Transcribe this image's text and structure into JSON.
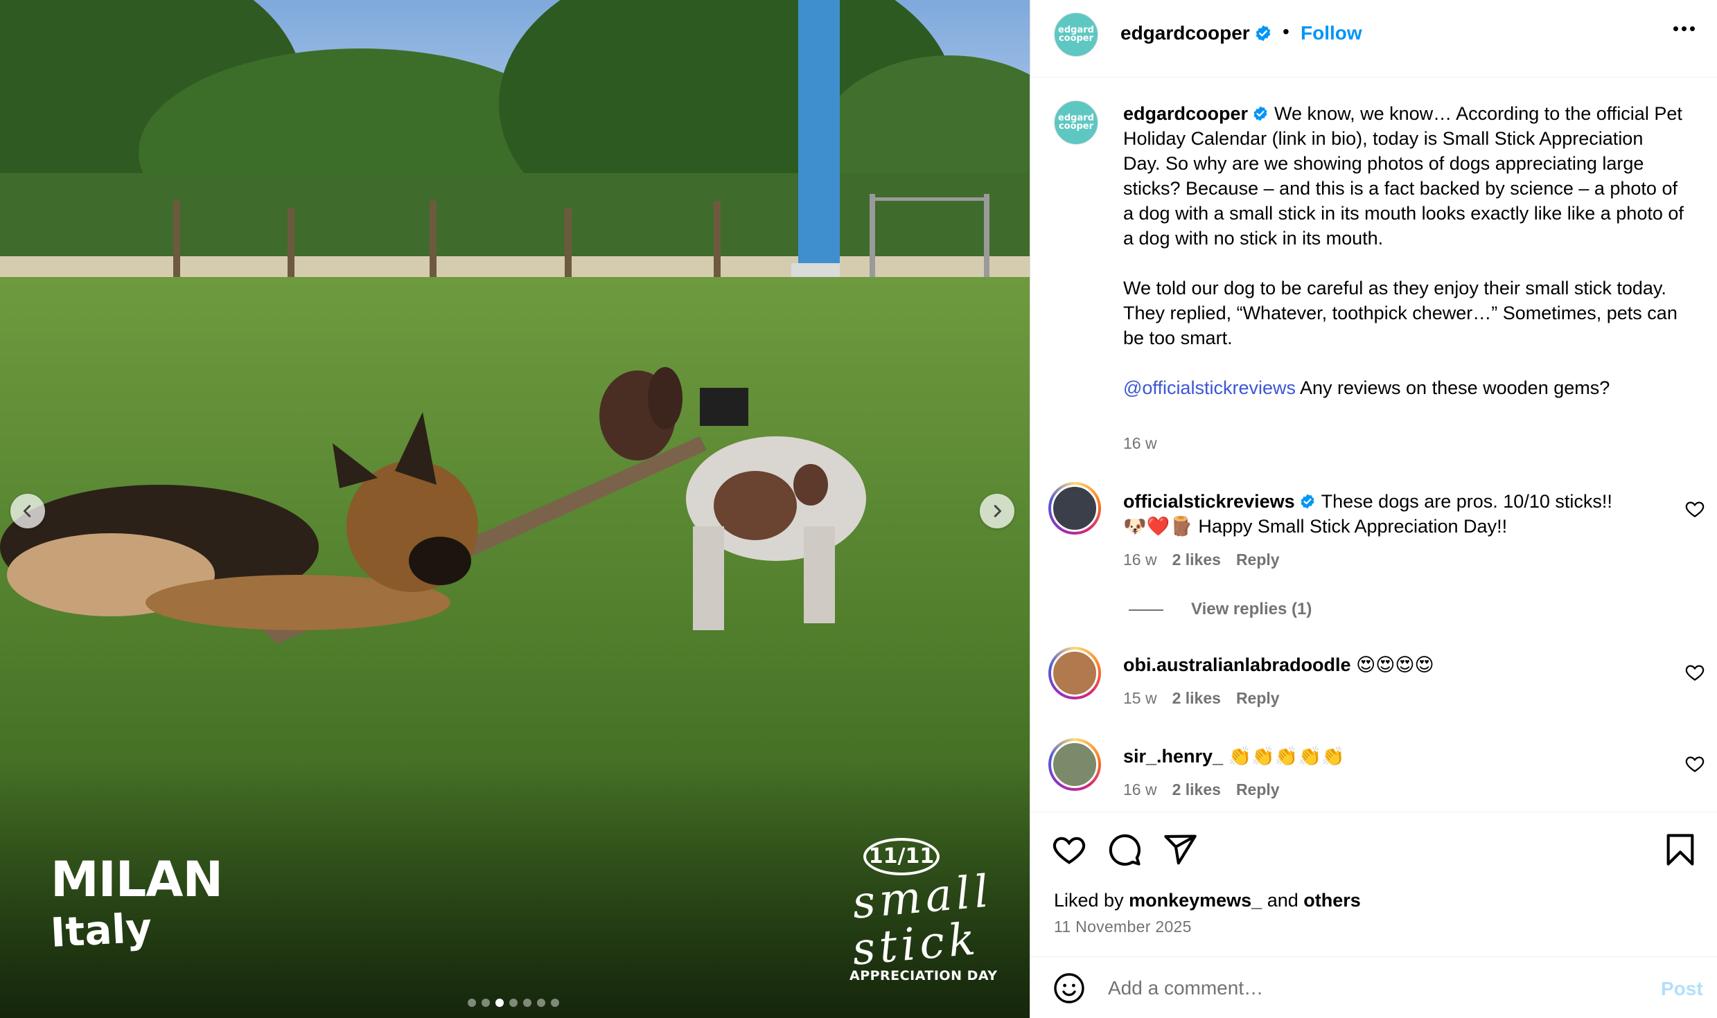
{
  "photo": {
    "city": "MILAN",
    "country": "Italy",
    "badge_date": "11/11",
    "badge_word_1": "small",
    "badge_word_2": "stick",
    "badge_sub": "APPRECIATION DAY",
    "carousel_total": 7,
    "carousel_active": 3
  },
  "header": {
    "avatar_text_1": "edgard",
    "avatar_text_2": "cooper",
    "username": "edgardcooper",
    "separator": "•",
    "follow_label": "Follow"
  },
  "caption": {
    "username": "edgardcooper",
    "para1": "We know, we know… According to the official Pet Holiday Calendar (link in bio), today is Small Stick Appreciation Day. So why are we showing photos of dogs appreciating large sticks? Because – and this is a fact backed by science – a photo of a dog with a small stick in its mouth looks exactly like like a photo of a dog with no stick in its mouth.",
    "para2": "We told our dog to be careful as they enjoy their small stick today. They replied, “Whatever, toothpick chewer…” Sometimes, pets can be too smart.",
    "mention": "@officialstickreviews",
    "para3_rest": " Any reviews on these wooden gems?",
    "time": "16 w"
  },
  "comments": [
    {
      "username": "officialstickreviews",
      "verified": true,
      "text_line1": "These dogs are pros. 10/10 sticks!!",
      "emoji": "🐶❤️🪵",
      "text_line2": "Happy Small Stick Appreciation Day!!",
      "time": "16 w",
      "likes": "2 likes",
      "reply": "Reply",
      "view_replies": "View replies (1)"
    },
    {
      "username": "obi.australianlabradoodle",
      "text": "😍😍😍😍",
      "time": "15 w",
      "likes": "2 likes",
      "reply": "Reply"
    },
    {
      "username": "sir_.henry_",
      "text": "👏👏👏👏👏",
      "time": "16 w",
      "likes": "2 likes",
      "reply": "Reply"
    }
  ],
  "actions": {
    "liked_prefix": "Liked by ",
    "liked_user": "monkeymews_",
    "liked_mid": " and ",
    "liked_others": "others",
    "date": "11 November 2025"
  },
  "comment_box": {
    "placeholder": "Add a comment…",
    "post_label": "Post"
  },
  "colors": {
    "link_blue": "#0095f6",
    "mention_blue": "#3d56d6",
    "muted_gray": "#737373",
    "brand_teal": "#5fc7c2"
  },
  "icons": [
    "chevron-left-icon",
    "chevron-right-icon",
    "verified-badge-icon",
    "more-options-icon",
    "heart-icon",
    "comment-icon",
    "share-icon",
    "bookmark-icon",
    "emoji-icon"
  ]
}
